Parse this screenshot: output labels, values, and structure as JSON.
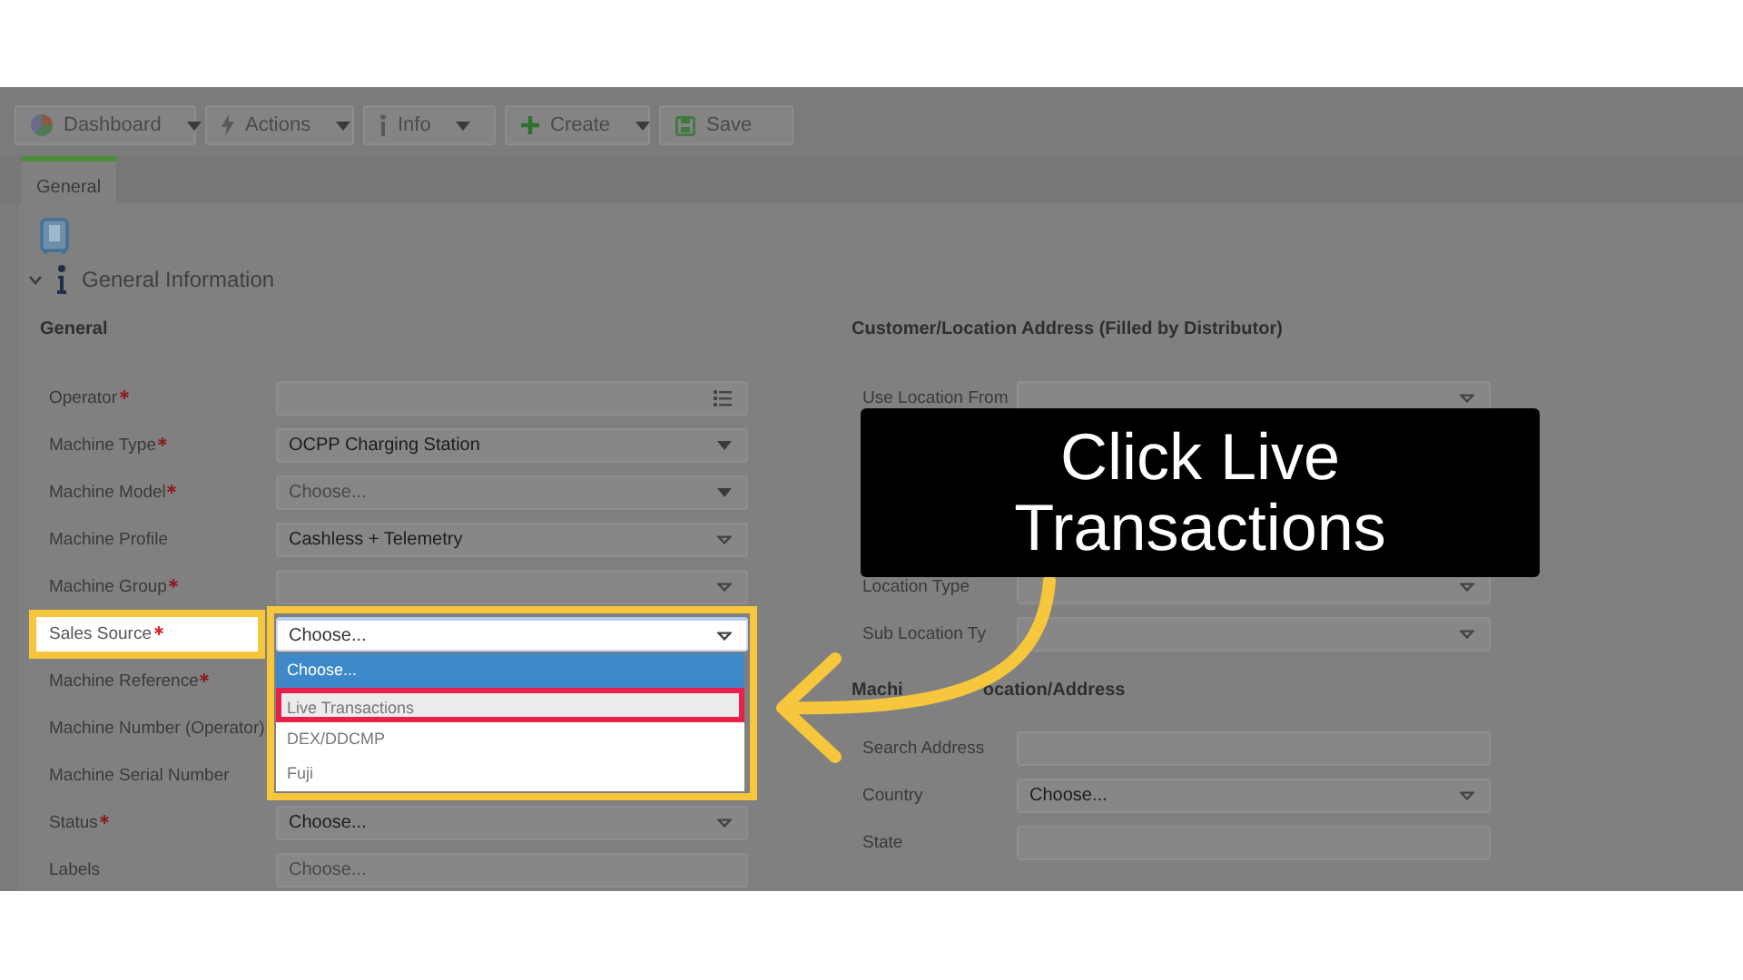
{
  "toolbar": [
    {
      "label": "Dashboard",
      "kind": "chart",
      "caret": true
    },
    {
      "label": "Actions",
      "kind": "action",
      "caret": true
    },
    {
      "label": "Info",
      "kind": "info",
      "caret": true
    },
    {
      "label": "Create",
      "kind": "add",
      "caret": true
    },
    {
      "label": "Save",
      "kind": "save",
      "caret": false
    }
  ],
  "tabs": [
    {
      "label": "General",
      "selected": true
    }
  ],
  "section": {
    "title": "General Information",
    "expanded": true
  },
  "left_column": {
    "heading": "General",
    "fields": [
      {
        "label": "Operator",
        "required": true,
        "highlighted": false,
        "kind": "lookup"
      },
      {
        "label": "Machine Type",
        "required": true,
        "highlighted": false,
        "kind": "dropdown",
        "value": "OCPP Charging Station"
      },
      {
        "label": "Machine Model",
        "required": true,
        "highlighted": false,
        "kind": "dropdown",
        "placeholder": "Choose..."
      },
      {
        "label": "Machine Profile",
        "required": false,
        "highlighted": false,
        "kind": "combo",
        "value": "Cashless + Telemetry"
      },
      {
        "label": "Machine Group",
        "required": true,
        "highlighted": false,
        "kind": "combo"
      },
      {
        "label": "Sales Source",
        "required": true,
        "highlighted": true,
        "kind": "combo",
        "value": "Choose...",
        "options": [
          {
            "label": "Choose...",
            "selected": true,
            "marked": false
          },
          {
            "label": "Live Transactions",
            "selected": false,
            "marked": true
          },
          {
            "label": "DEX/DDCMP",
            "selected": false,
            "marked": false
          },
          {
            "label": "Fuji",
            "selected": false,
            "marked": false
          }
        ]
      },
      {
        "label": "Machine Reference",
        "required": true,
        "highlighted": false
      },
      {
        "label": "Machine Number (Operator)",
        "required": false,
        "highlighted": false
      },
      {
        "label": "Machine Serial Number",
        "required": false,
        "highlighted": false
      },
      {
        "label": "Status",
        "required": true,
        "highlighted": false,
        "kind": "combo",
        "value": "Choose..."
      },
      {
        "label": "Labels",
        "required": false,
        "highlighted": false,
        "kind": "text",
        "placeholder": "Choose..."
      }
    ]
  },
  "right_column": {
    "heading": "Customer/Location Address (Filled by Distributor)",
    "fields_top": [
      {
        "label": "Use Location From",
        "kind": "combo"
      }
    ],
    "fields_middle": [
      {
        "label": "Location Type",
        "kind": "combo"
      },
      {
        "label": "Sub Location Ty",
        "kind": "combo"
      }
    ],
    "heading_2_visible_parts": [
      "Machi",
      "ocation/Address"
    ],
    "fields_bottom": [
      {
        "label": "Search Address",
        "kind": "text"
      },
      {
        "label": "Country",
        "kind": "combo",
        "value": "Choose..."
      },
      {
        "label": "State",
        "kind": "text"
      }
    ]
  },
  "callout": {
    "text": "Click Live Transactions"
  }
}
